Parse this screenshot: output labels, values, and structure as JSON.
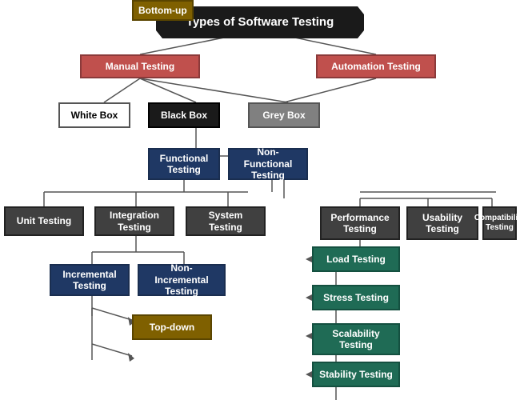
{
  "title": "Types of Software Testing",
  "nodes": {
    "root": "Types of Software Testing",
    "manual": "Manual Testing",
    "automation": "Automation Testing",
    "whitebox": "White Box",
    "blackbox": "Black Box",
    "greybox": "Grey Box",
    "functional": "Functional Testing",
    "nonfunctional": "Non-Functional Testing",
    "unit": "Unit Testing",
    "integration": "Integration Testing",
    "system": "System Testing",
    "performance": "Performance Testing",
    "usability": "Usability Testing",
    "compatibility": "Compatibility Testing",
    "incremental": "Incremental Testing",
    "nonincremental": "Non-Incremental Testing",
    "topdown": "Top-down",
    "bottomup": "Bottom-up",
    "load": "Load Testing",
    "stress": "Stress Testing",
    "scalability": "Scalability Testing",
    "stability": "Stability Testing"
  }
}
